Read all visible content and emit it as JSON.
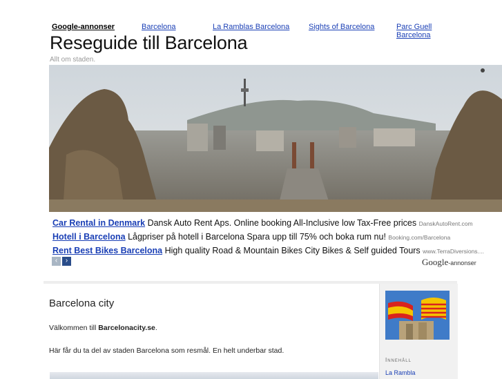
{
  "top_ads": {
    "label": "Google-annonser",
    "links": [
      "Barcelona",
      "La Ramblas Barcelona",
      "Sights of Barcelona",
      "Parc Guell Barcelona"
    ]
  },
  "site": {
    "title": "Reseguide till Barcelona",
    "tagline": "Allt om staden."
  },
  "ads": [
    {
      "title": "Car Rental in Denmark",
      "text": "Dansk Auto Rent Aps. Online booking All-Inclusive low Tax-Free prices",
      "url": "DanskAutoRent.com"
    },
    {
      "title": "Hotell i Barcelona",
      "text": "Lågpriser på hotell i Barcelona Spara upp till 75% och boka rum nu!",
      "url": "Booking.com/Barcelona"
    },
    {
      "title": "Rent Best Bikes Barcelona",
      "text": "High quality Road & Mountain Bikes City Bikes & Self guided Tours",
      "url": "www.TerraDiversions...."
    }
  ],
  "ad_nav": {
    "prev": "‹",
    "next": "›"
  },
  "google_ads_label": {
    "brand": "Google",
    "suffix": "-annonser"
  },
  "main": {
    "heading": "Barcelona city",
    "welcome_prefix": "Välkommen till ",
    "welcome_site": "Barcelonacity.se",
    "welcome_suffix": ".",
    "intro": "Här får du ta del av staden Barcelona som resmål. En helt underbar stad."
  },
  "sidebar": {
    "heading": "Innehåll",
    "links": [
      "La Rambla"
    ]
  },
  "icons": {
    "prev": "chevron-left-icon",
    "next": "chevron-right-icon"
  },
  "colors": {
    "link": "#1a3fb5",
    "nav_active": "#2a4d8a",
    "nav_inactive": "#a9b6c4",
    "sidebar_bg": "#f1f1f1"
  }
}
